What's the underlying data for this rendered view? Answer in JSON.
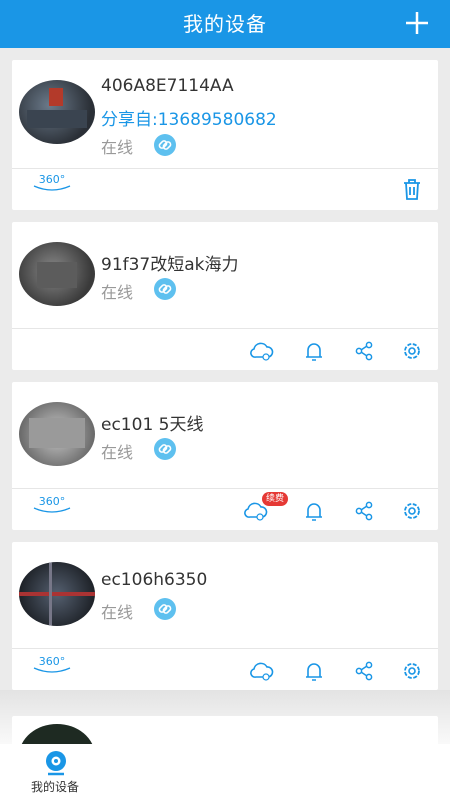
{
  "header": {
    "title": "我的设备",
    "add_icon": "plus-icon"
  },
  "devices": [
    {
      "name": "406A8E7114AA",
      "shared_from": "分享自:13689580682",
      "status": "在线"
    },
    {
      "name": "91f37改短ak海力",
      "status": "在线"
    },
    {
      "name": "ec101 5天线",
      "status": "在线",
      "badge": "续费"
    },
    {
      "name": "ec106h6350",
      "status": "在线"
    }
  ],
  "icons": {
    "view360": "360°",
    "delete": "trash-icon",
    "cloud": "cloud-icon",
    "alarm": "bell-icon",
    "share": "share-icon",
    "settings": "gear-icon",
    "link": "link-icon"
  },
  "bottom_nav": {
    "tab": "我的设备"
  },
  "colors": {
    "primary": "#1a96e6",
    "status_gray": "#999999",
    "badge_red": "#e53935"
  }
}
